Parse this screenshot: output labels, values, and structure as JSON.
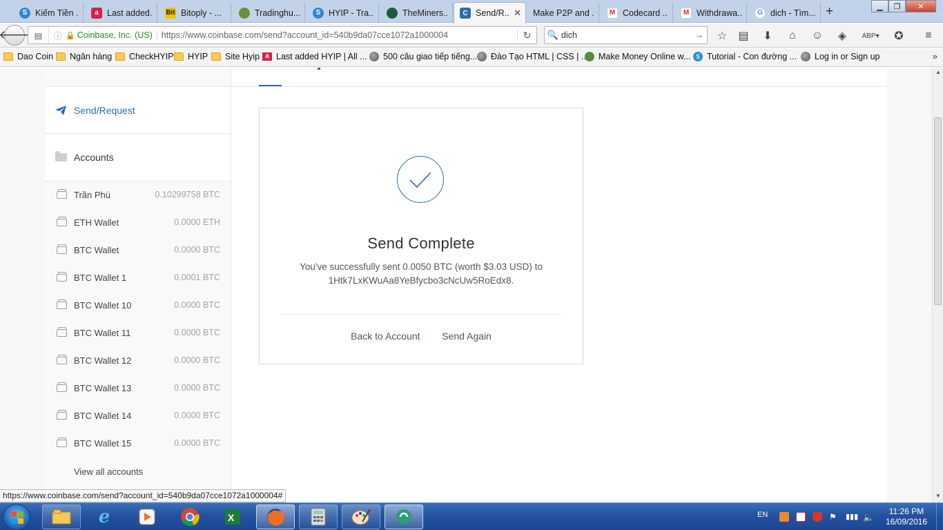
{
  "browser": {
    "tabs": [
      {
        "label": "Kiếm Tiền ...",
        "icon": "hyip-icon",
        "color": "#2f86d6"
      },
      {
        "label": "Last added...",
        "icon": "a-letter-icon",
        "color": "#d6204f"
      },
      {
        "label": "Bitoply - ...",
        "icon": "bitoply-icon",
        "color": "#f2c200"
      },
      {
        "label": "Tradinghu...",
        "icon": "tradinghub-icon",
        "color": "#6c8f3a"
      },
      {
        "label": "HYIP - Tra...",
        "icon": "hyip-icon",
        "color": "#2f86d6"
      },
      {
        "label": "TheMiners...",
        "icon": "theminers-icon",
        "color": "#1e5b3a"
      },
      {
        "label": "Send/R...",
        "icon": "coinbase-icon",
        "color": "#2b6cb0",
        "active": true
      },
      {
        "label": "Make P2P and ...",
        "icon": "",
        "color": ""
      },
      {
        "label": "Codecard ...",
        "icon": "gmail-icon",
        "color": "#d93025"
      },
      {
        "label": "Withdrawa...",
        "icon": "gmail-icon",
        "color": "#d93025"
      },
      {
        "label": "dich - Tìm...",
        "icon": "google-icon",
        "color": "#4285f4"
      }
    ],
    "new_tab": "+",
    "address": {
      "org": "Coinbase, Inc. (US)",
      "url": "https://www.coinbase.com/send?account_id=540b9da07cce1072a1000004"
    },
    "search": {
      "value": "dich"
    },
    "bookmarks": [
      {
        "label": "Dao Coin",
        "icon": "folder-icon"
      },
      {
        "label": "Ngân hàng",
        "icon": "folder-icon"
      },
      {
        "label": "CheckHYIP",
        "icon": "folder-icon"
      },
      {
        "label": "HYIP",
        "icon": "folder-icon"
      },
      {
        "label": "Site Hyip",
        "icon": "folder-icon"
      },
      {
        "label": "Last added HYIP | All ...",
        "icon": "a-letter-icon"
      },
      {
        "label": "500 câu giao tiếp tiếng...",
        "icon": "globe-icon"
      },
      {
        "label": "Đào Tạo HTML | CSS | ...",
        "icon": "globe-icon"
      },
      {
        "label": "Make Money Online w...",
        "icon": "frog-icon"
      },
      {
        "label": "Tutorial - Con đường ...",
        "icon": "dollar-icon"
      },
      {
        "label": "Log in or Sign up",
        "icon": "globe-icon"
      }
    ],
    "bookmarks_more": "»",
    "status_url": "https://www.coinbase.com/send?account_id=540b9da07cce1072a1000004#"
  },
  "sidebar": {
    "send_request": "Send/Request",
    "accounts_header": "Accounts",
    "accounts": [
      {
        "name": "Trần Phú",
        "balance": "0.10299758 BTC"
      },
      {
        "name": "ETH Wallet",
        "balance": "0.0000 ETH"
      },
      {
        "name": "BTC Wallet",
        "balance": "0.0000 BTC"
      },
      {
        "name": "BTC Wallet 1",
        "balance": "0.0001 BTC"
      },
      {
        "name": "BTC Wallet 10",
        "balance": "0.0000 BTC"
      },
      {
        "name": "BTC Wallet 11",
        "balance": "0.0000 BTC"
      },
      {
        "name": "BTC Wallet 12",
        "balance": "0.0000 BTC"
      },
      {
        "name": "BTC Wallet 13",
        "balance": "0.0000 BTC"
      },
      {
        "name": "BTC Wallet 14",
        "balance": "0.0000 BTC"
      },
      {
        "name": "BTC Wallet 15",
        "balance": "0.0000 BTC"
      }
    ],
    "view_all": "View all accounts"
  },
  "main": {
    "card": {
      "title": "Send Complete",
      "message_line1": "You've successfully sent 0.0050 BTC (worth $3.03 USD) to",
      "message_line2": "1Htk7LxKWuAa8YeBfycbo3cNcUw5RoEdx8.",
      "back_to_account": "Back to Account",
      "separator": "·",
      "send_again": "Send Again"
    }
  },
  "taskbar": {
    "apps": [
      "explorer-icon",
      "ie-icon",
      "media-player-icon",
      "chrome-icon",
      "excel-icon",
      "firefox-icon",
      "calculator-icon",
      "paint-icon",
      "vpn-icon"
    ],
    "language": "EN",
    "time": "11:26 PM",
    "date": "16/09/2016"
  },
  "colors": {
    "accent": "#2b6cb0",
    "taskbar": "#2452a0"
  }
}
